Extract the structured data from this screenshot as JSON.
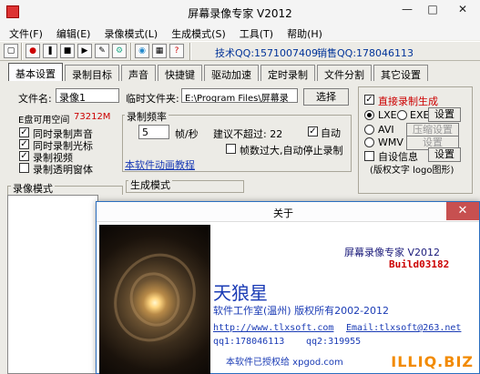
{
  "window": {
    "title": "屏幕录像专家 V2012"
  },
  "menu": [
    "文件(F)",
    "编辑(E)",
    "录像模式(L)",
    "生成模式(S)",
    "工具(T)",
    "帮助(H)"
  ],
  "toolbar": {
    "tech_qq": "技术QQ:1571007409",
    "sales_qq": "销售QQ:178046113"
  },
  "tabs": [
    "基本设置",
    "录制目标",
    "声音",
    "快捷键",
    "驱动加速",
    "定时录制",
    "文件分割",
    "其它设置"
  ],
  "settings": {
    "filename_label": "文件名:",
    "filename_value": "录像1",
    "tempfolder_label": "临时文件夹:",
    "tempfolder_value": "E:\\Program Files\\屏幕录",
    "select_btn": "选择",
    "disk_space_label": "E盘可用空间",
    "disk_space_value": "73212M",
    "checks": [
      {
        "label": "同时录制声音",
        "checked": true
      },
      {
        "label": "同时录制光标",
        "checked": true
      },
      {
        "label": "录制视频",
        "checked": true
      },
      {
        "label": "录制透明窗体",
        "checked": false
      }
    ],
    "framerate_group": "录制频率",
    "framerate_value": "5",
    "framerate_unit": "帧/秒",
    "suggest_label": "建议不超过: 22",
    "auto_label": "自动",
    "auto_stop_label": "帧数过大,自动停止录制",
    "tutorial_link": "本软件动画教程"
  },
  "right_panel": {
    "direct_gen": "直接录制生成",
    "lxe": "LXE",
    "exe": "EXE",
    "set1": "设置",
    "avi": "AVI",
    "compress": "压缩设置",
    "wmv": "WMV",
    "set2": "设置",
    "auto_info": "自设信息",
    "set3": "设置",
    "watermark_note": "(版权文字 logo图形)"
  },
  "sections": {
    "record_mode": "录像模式",
    "gen_mode": "生成模式"
  },
  "about": {
    "title": "关于",
    "app_name": "屏幕录像专家  V2012",
    "build": "Build03182",
    "brand": "天狼星",
    "copyright": "软件工作室(温州) 版权所有2002-2012",
    "website": "http://www.tlxsoft.com",
    "email": "Email:tlxsoft@263.net",
    "qq1": "qq1:178046113",
    "qq2": "qq2:319955",
    "license": "本软件已授权给 xpgod.com"
  },
  "watermark": "ILLIQ.BIZ",
  "colors": {
    "accent_red": "#cc0000",
    "link_blue": "#1a3bb5",
    "dialog_border": "#2a6ebf"
  }
}
